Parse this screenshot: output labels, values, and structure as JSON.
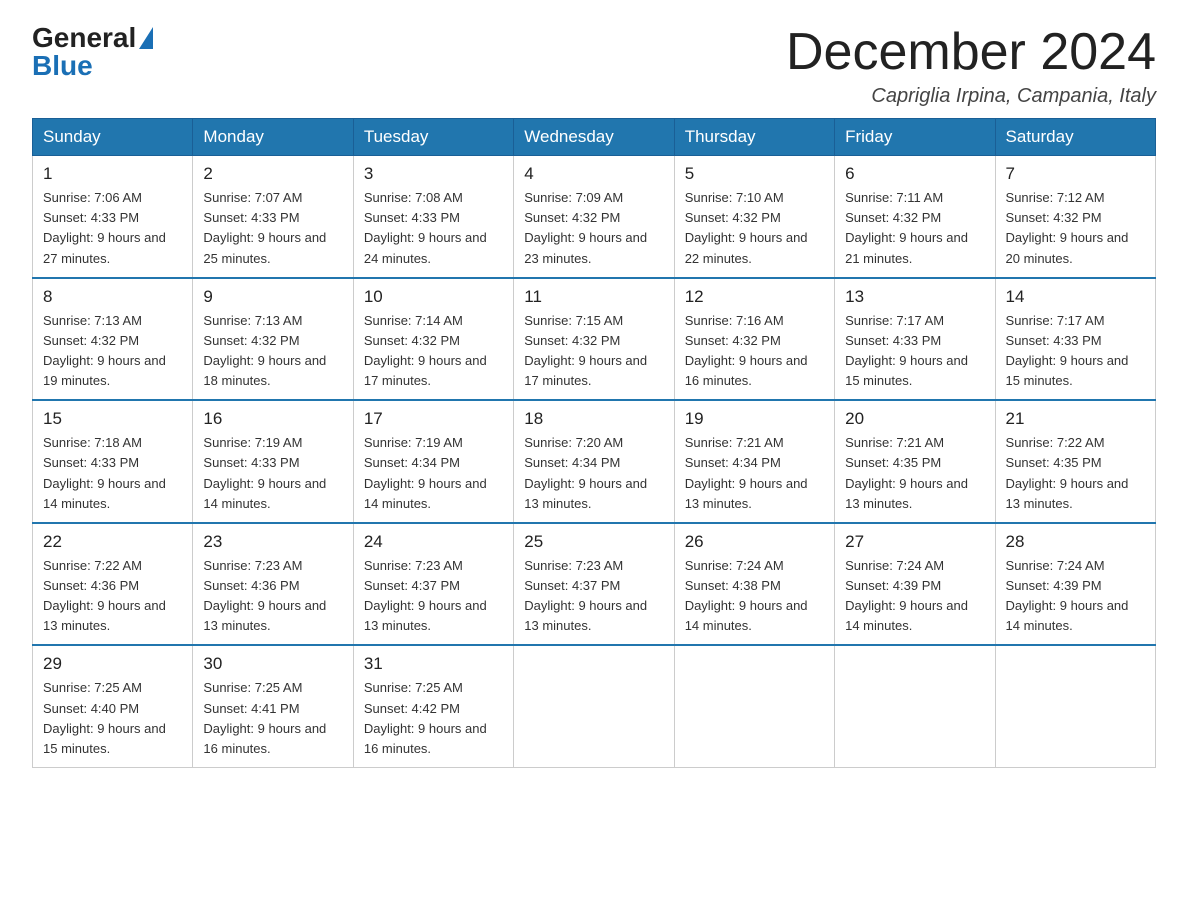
{
  "logo": {
    "general": "General",
    "blue": "Blue"
  },
  "title": {
    "month_year": "December 2024",
    "location": "Capriglia Irpina, Campania, Italy"
  },
  "weekdays": [
    "Sunday",
    "Monday",
    "Tuesday",
    "Wednesday",
    "Thursday",
    "Friday",
    "Saturday"
  ],
  "weeks": [
    [
      {
        "day": "1",
        "sunrise": "7:06 AM",
        "sunset": "4:33 PM",
        "daylight": "9 hours and 27 minutes."
      },
      {
        "day": "2",
        "sunrise": "7:07 AM",
        "sunset": "4:33 PM",
        "daylight": "9 hours and 25 minutes."
      },
      {
        "day": "3",
        "sunrise": "7:08 AM",
        "sunset": "4:33 PM",
        "daylight": "9 hours and 24 minutes."
      },
      {
        "day": "4",
        "sunrise": "7:09 AM",
        "sunset": "4:32 PM",
        "daylight": "9 hours and 23 minutes."
      },
      {
        "day": "5",
        "sunrise": "7:10 AM",
        "sunset": "4:32 PM",
        "daylight": "9 hours and 22 minutes."
      },
      {
        "day": "6",
        "sunrise": "7:11 AM",
        "sunset": "4:32 PM",
        "daylight": "9 hours and 21 minutes."
      },
      {
        "day": "7",
        "sunrise": "7:12 AM",
        "sunset": "4:32 PM",
        "daylight": "9 hours and 20 minutes."
      }
    ],
    [
      {
        "day": "8",
        "sunrise": "7:13 AM",
        "sunset": "4:32 PM",
        "daylight": "9 hours and 19 minutes."
      },
      {
        "day": "9",
        "sunrise": "7:13 AM",
        "sunset": "4:32 PM",
        "daylight": "9 hours and 18 minutes."
      },
      {
        "day": "10",
        "sunrise": "7:14 AM",
        "sunset": "4:32 PM",
        "daylight": "9 hours and 17 minutes."
      },
      {
        "day": "11",
        "sunrise": "7:15 AM",
        "sunset": "4:32 PM",
        "daylight": "9 hours and 17 minutes."
      },
      {
        "day": "12",
        "sunrise": "7:16 AM",
        "sunset": "4:32 PM",
        "daylight": "9 hours and 16 minutes."
      },
      {
        "day": "13",
        "sunrise": "7:17 AM",
        "sunset": "4:33 PM",
        "daylight": "9 hours and 15 minutes."
      },
      {
        "day": "14",
        "sunrise": "7:17 AM",
        "sunset": "4:33 PM",
        "daylight": "9 hours and 15 minutes."
      }
    ],
    [
      {
        "day": "15",
        "sunrise": "7:18 AM",
        "sunset": "4:33 PM",
        "daylight": "9 hours and 14 minutes."
      },
      {
        "day": "16",
        "sunrise": "7:19 AM",
        "sunset": "4:33 PM",
        "daylight": "9 hours and 14 minutes."
      },
      {
        "day": "17",
        "sunrise": "7:19 AM",
        "sunset": "4:34 PM",
        "daylight": "9 hours and 14 minutes."
      },
      {
        "day": "18",
        "sunrise": "7:20 AM",
        "sunset": "4:34 PM",
        "daylight": "9 hours and 13 minutes."
      },
      {
        "day": "19",
        "sunrise": "7:21 AM",
        "sunset": "4:34 PM",
        "daylight": "9 hours and 13 minutes."
      },
      {
        "day": "20",
        "sunrise": "7:21 AM",
        "sunset": "4:35 PM",
        "daylight": "9 hours and 13 minutes."
      },
      {
        "day": "21",
        "sunrise": "7:22 AM",
        "sunset": "4:35 PM",
        "daylight": "9 hours and 13 minutes."
      }
    ],
    [
      {
        "day": "22",
        "sunrise": "7:22 AM",
        "sunset": "4:36 PM",
        "daylight": "9 hours and 13 minutes."
      },
      {
        "day": "23",
        "sunrise": "7:23 AM",
        "sunset": "4:36 PM",
        "daylight": "9 hours and 13 minutes."
      },
      {
        "day": "24",
        "sunrise": "7:23 AM",
        "sunset": "4:37 PM",
        "daylight": "9 hours and 13 minutes."
      },
      {
        "day": "25",
        "sunrise": "7:23 AM",
        "sunset": "4:37 PM",
        "daylight": "9 hours and 13 minutes."
      },
      {
        "day": "26",
        "sunrise": "7:24 AM",
        "sunset": "4:38 PM",
        "daylight": "9 hours and 14 minutes."
      },
      {
        "day": "27",
        "sunrise": "7:24 AM",
        "sunset": "4:39 PM",
        "daylight": "9 hours and 14 minutes."
      },
      {
        "day": "28",
        "sunrise": "7:24 AM",
        "sunset": "4:39 PM",
        "daylight": "9 hours and 14 minutes."
      }
    ],
    [
      {
        "day": "29",
        "sunrise": "7:25 AM",
        "sunset": "4:40 PM",
        "daylight": "9 hours and 15 minutes."
      },
      {
        "day": "30",
        "sunrise": "7:25 AM",
        "sunset": "4:41 PM",
        "daylight": "9 hours and 16 minutes."
      },
      {
        "day": "31",
        "sunrise": "7:25 AM",
        "sunset": "4:42 PM",
        "daylight": "9 hours and 16 minutes."
      },
      null,
      null,
      null,
      null
    ]
  ]
}
